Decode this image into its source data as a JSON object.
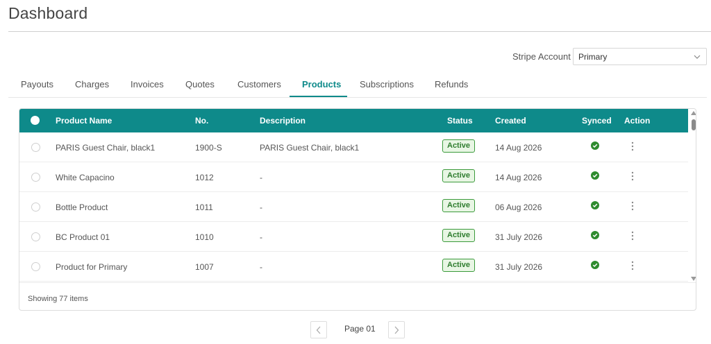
{
  "page": {
    "title": "Dashboard"
  },
  "account": {
    "label": "Stripe Account",
    "selected": "Primary",
    "icon": "chevron-down-icon"
  },
  "tabs": [
    {
      "label": "Payouts",
      "active": false
    },
    {
      "label": "Charges",
      "active": false
    },
    {
      "label": "Invoices",
      "active": false
    },
    {
      "label": "Quotes",
      "active": false
    },
    {
      "label": "Customers",
      "active": false
    },
    {
      "label": "Products",
      "active": true
    },
    {
      "label": "Subscriptions",
      "active": false
    },
    {
      "label": "Refunds",
      "active": false
    }
  ],
  "table": {
    "columns": {
      "name": "Product Name",
      "number": "No.",
      "description": "Description",
      "status": "Status",
      "created": "Created",
      "synced": "Synced",
      "action": "Action"
    },
    "rows": [
      {
        "name": "PARIS Guest Chair, black1",
        "number": "1900-S",
        "description": "PARIS Guest Chair, black1",
        "status": "Active",
        "created": "14 Aug 2026",
        "synced": true
      },
      {
        "name": "White Capacino",
        "number": "1012",
        "description": "-",
        "status": "Active",
        "created": "14 Aug 2026",
        "synced": true
      },
      {
        "name": "Bottle Product",
        "number": "1011",
        "description": "-",
        "status": "Active",
        "created": "06 Aug 2026",
        "synced": true
      },
      {
        "name": "BC Product 01",
        "number": "1010",
        "description": "-",
        "status": "Active",
        "created": "31 July 2026",
        "synced": true
      },
      {
        "name": "Product for Primary",
        "number": "1007",
        "description": "-",
        "status": "Active",
        "created": "31 July 2026",
        "synced": true
      }
    ],
    "footer": "Showing 77 items"
  },
  "pagination": {
    "label": "Page 01",
    "prev_icon": "chevron-left-icon",
    "next_icon": "chevron-right-icon"
  },
  "colors": {
    "accent": "#0e8a8a",
    "active_badge_bg": "#e8f6e4",
    "active_badge_border": "#3a9a3a",
    "synced": "#2e8b2e"
  }
}
